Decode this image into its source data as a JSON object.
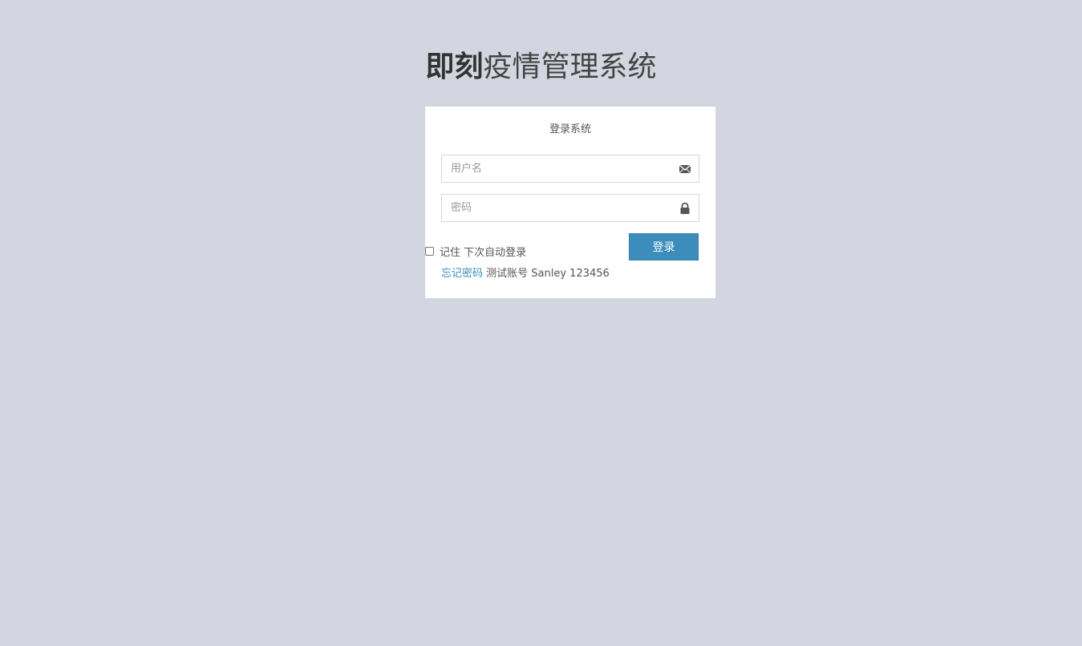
{
  "header": {
    "title_bold": "即刻",
    "title_rest": "疫情管理系统"
  },
  "login": {
    "heading": "登录系统",
    "username_placeholder": "用户名",
    "password_placeholder": "密码",
    "remember_label": "记住 下次自动登录",
    "remember_checked": false,
    "submit_label": "登录",
    "forgot_link": "忘记密码",
    "test_account_text": "测试账号 Sanley 123456"
  },
  "icons": {
    "username": "envelope-icon",
    "password": "lock-icon"
  },
  "colors": {
    "background": "#d3d6e0",
    "primary": "#3c8dbc",
    "panel": "#ffffff"
  }
}
